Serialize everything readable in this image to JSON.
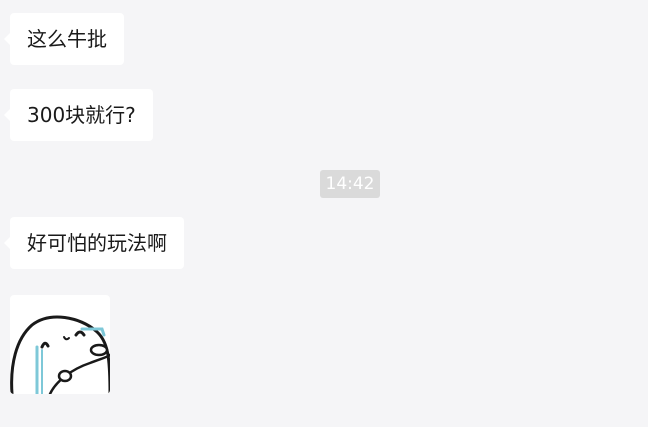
{
  "chat": {
    "messages": [
      {
        "sender": "other",
        "text": "这么牛批"
      },
      {
        "sender": "other",
        "text": "300块就行?"
      },
      {
        "sender": "other",
        "text": "好可怕的玩法啊"
      }
    ],
    "timestamp": "14:42",
    "sticker": {
      "icon": "crying-blob-sticker",
      "accent_color": "#7ec8d8"
    }
  },
  "colors": {
    "background": "#f5f5f7",
    "bubble": "#ffffff",
    "timestamp_bg": "#dadada",
    "text": "#1a1a1a"
  }
}
